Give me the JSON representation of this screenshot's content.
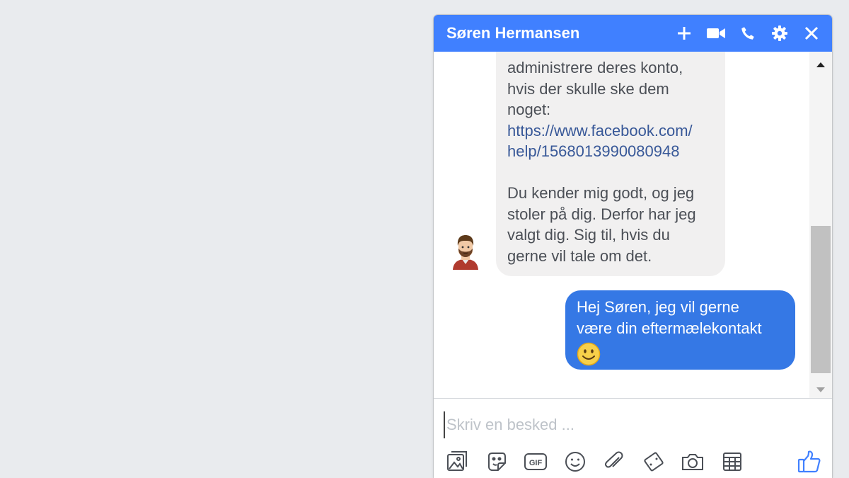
{
  "chat": {
    "title": "Søren Hermansen",
    "header_icons": [
      "plus-icon",
      "video-camera-icon",
      "phone-icon",
      "gear-icon",
      "close-icon"
    ]
  },
  "messages": {
    "incoming": {
      "lines": [
        "administrere deres konto,",
        "hvis der skulle ske dem",
        "noget:"
      ],
      "link_lines": [
        "https://www.facebook.com/",
        "help/1568013990080948"
      ],
      "lines_2": [
        "Du kender mig godt, og jeg",
        "stoler på dig. Derfor har jeg",
        "valgt dig. Sig til, hvis du",
        "gerne vil tale om det."
      ]
    },
    "outgoing": {
      "lines": [
        "Hej Søren, jeg vil gerne",
        "være din eftermælekontakt"
      ],
      "emoji": "smiley-emoji"
    }
  },
  "composer": {
    "placeholder": "Skriv en besked ...",
    "value": "",
    "tools": [
      "photo-icon",
      "sticker-icon",
      "gif-icon",
      "emoji-icon",
      "attachment-icon",
      "game-icon",
      "camera-icon",
      "grid-icon"
    ],
    "like": "thumbs-up-icon"
  },
  "colors": {
    "background": "#e9ebee",
    "header": "#4080ff",
    "outgoing_bubble": "#3578e5",
    "incoming_bubble": "#f1f0f0",
    "link": "#385898"
  }
}
